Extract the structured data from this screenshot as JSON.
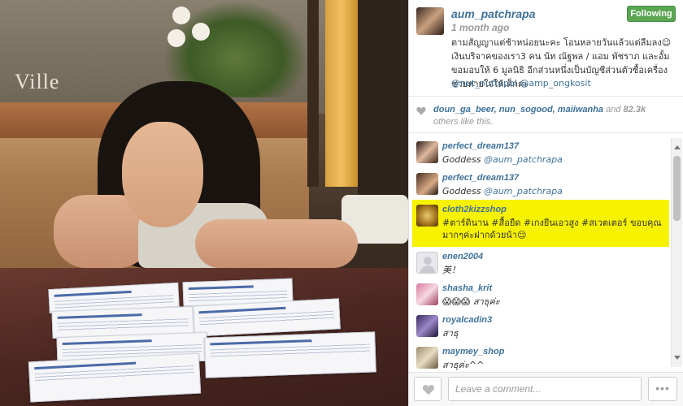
{
  "post": {
    "username": "aum_patchrapa",
    "time": "1 month ago",
    "follow_label": "Following",
    "caption": "ตามสัญญาแต่ช้าหน่อยนะคะ โอนหลายวันแล้วแต่ลืมลง😉 เงินบริจาคของเรา3 คน น้ท ณัฐพล / แอม พัชราภ และอั้ม ขอมอบให้ 6 มูลนิธิ อีกส่วนหนึ่งเป็นบัญชีส่วนตัวซื้อเครื่องช่วยหายใจให้เด็กค่ะ",
    "caption_mentions": "@nut_nuttapol @amp_ongkosit"
  },
  "photo": {
    "sign_text": "Ville"
  },
  "likes": {
    "names": "doun_ga_beer, nun_sogood, maiiwanha",
    "and_text": "and",
    "count": "82.3k",
    "rest": "others like this."
  },
  "comments": [
    {
      "user": "perfect_dream137",
      "text": "Goddess ",
      "mention": "@aum_patchrapa",
      "avatar": "av-photo1"
    },
    {
      "user": "perfect_dream137",
      "text": "Goddess ",
      "mention": "@aum_patchrapa",
      "avatar": "av-photo1"
    },
    {
      "user": "cloth2kizzshop",
      "text": "#ตาร์ดินาน #สื้อยืด #เกงยีนเอวสูง #สเวตเตอร์ ขอบคุณมากๆค่ะฝากด้วยน้า😌",
      "mention": "",
      "avatar": "av-shop",
      "highlighted": true
    },
    {
      "user": "enen2004",
      "text": "美！",
      "mention": "",
      "avatar": "av-default"
    },
    {
      "user": "shasha_krit",
      "text": "😱😱😱 สาธุค่ะ",
      "mention": "",
      "avatar": "av-shasha"
    },
    {
      "user": "royalcadin3",
      "text": "สาธุ",
      "mention": "",
      "avatar": "av-royal"
    },
    {
      "user": "maymey_shop",
      "text": "สาธุค่ะ^^",
      "mention": "",
      "avatar": "av-maymey"
    }
  ],
  "footer": {
    "comment_placeholder": "Leave a comment...",
    "more_label": "•••"
  },
  "colors": {
    "link": "#3f729b",
    "following_green": "#5aa652",
    "highlight_yellow": "#f7f200"
  }
}
